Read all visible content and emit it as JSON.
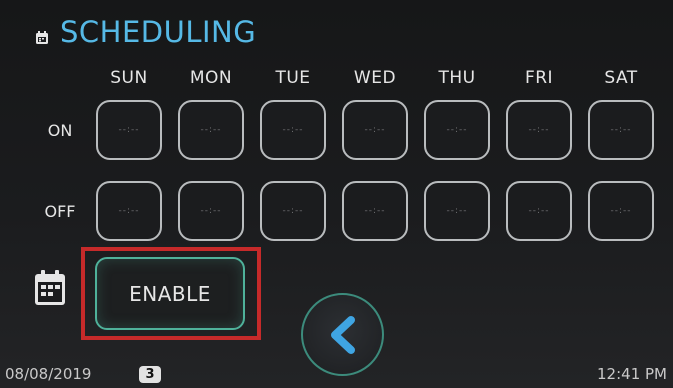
{
  "header": {
    "title": "SCHEDULING",
    "icon": "calendar-small-icon"
  },
  "days": [
    "SUN",
    "MON",
    "TUE",
    "WED",
    "THU",
    "FRI",
    "SAT"
  ],
  "rows": [
    {
      "label": "ON",
      "values": [
        "--:--",
        "--:--",
        "--:--",
        "--:--",
        "--:--",
        "--:--",
        "--:--"
      ]
    },
    {
      "label": "OFF",
      "values": [
        "--:--",
        "--:--",
        "--:--",
        "--:--",
        "--:--",
        "--:--",
        "--:--"
      ]
    }
  ],
  "enable_button": {
    "label": "ENABLE",
    "icon": "calendar-grid-icon"
  },
  "back_button": {
    "icon": "chevron-left-icon"
  },
  "status_bar": {
    "date": "08/08/2019",
    "badge": "3",
    "time": "12:41 PM"
  },
  "colors": {
    "title": "#56b9e6",
    "accent": "#4fb19a",
    "highlight": "#c62a2a",
    "back_chevron": "#3fa5e3"
  }
}
